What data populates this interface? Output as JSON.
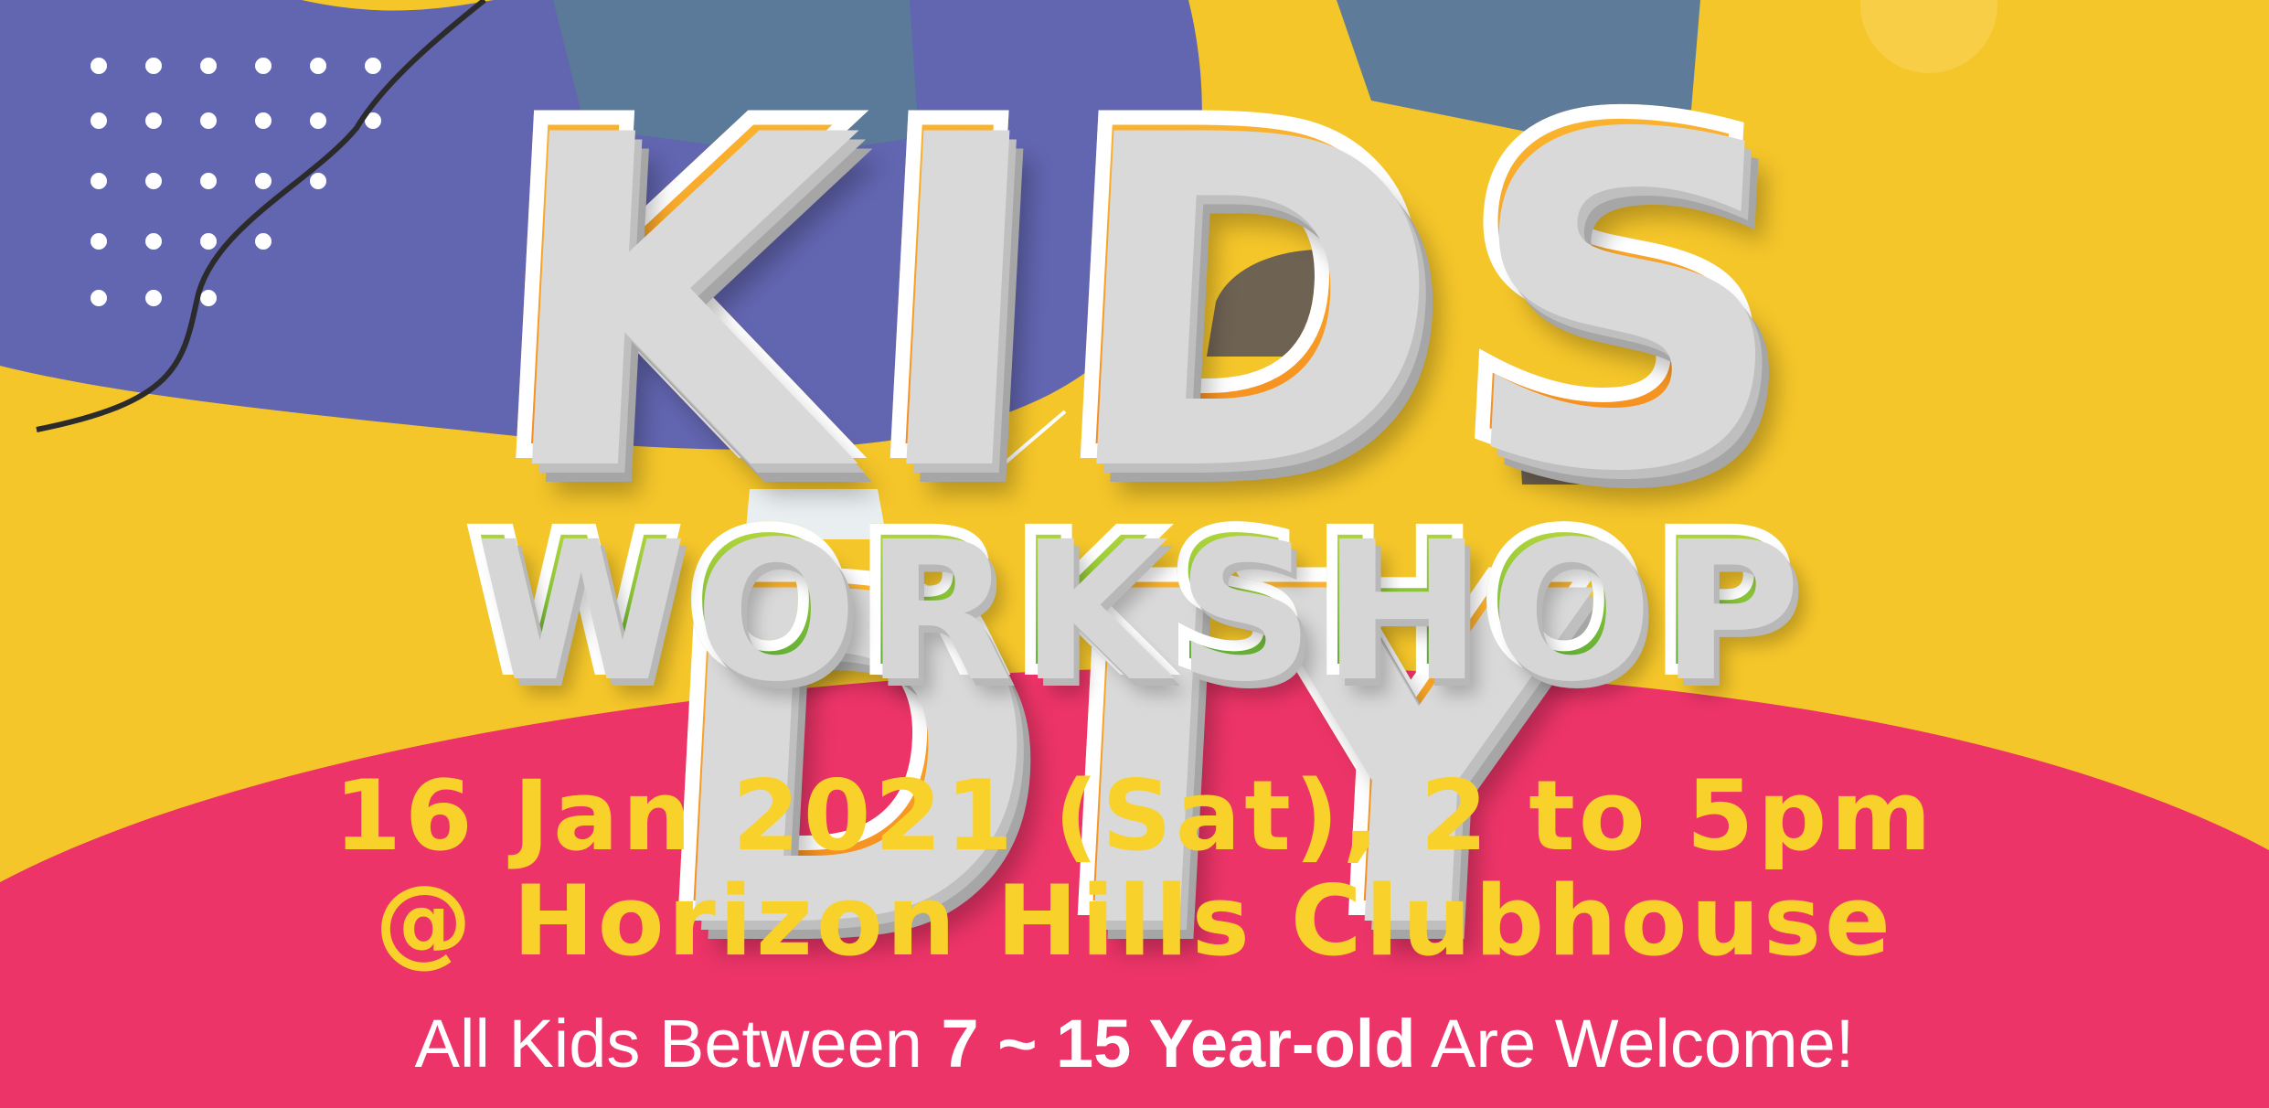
{
  "poster": {
    "title": "KIDS DIY",
    "subtitle": "WORKSHOP",
    "date_line": "16 Jan 2021 (Sat), 2 to 5pm",
    "venue_line": "@ Horizon Hills Clubhouse",
    "note_prefix": "All Kids Between ",
    "note_age": "7 ~ 15 Year-old",
    "note_suffix": " Are Welcome!"
  },
  "colors": {
    "background_yellow": "#f5c62a",
    "purple_blob": "#6265b0",
    "pink_arc": "#ec3468",
    "title_orange": "#f79d24",
    "subtitle_green": "#7ebd2f",
    "info_yellow": "#f9d12b"
  }
}
